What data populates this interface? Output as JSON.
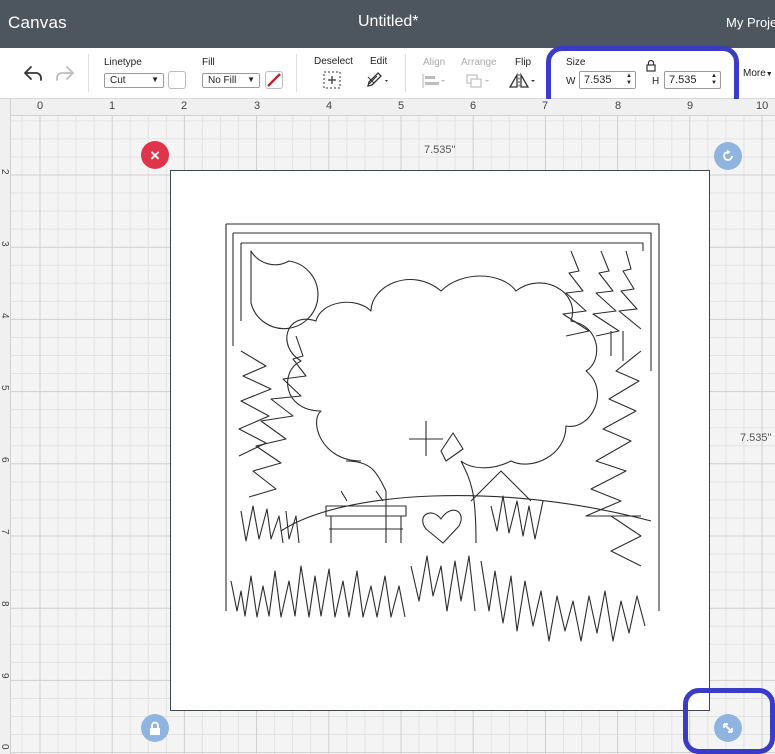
{
  "header": {
    "app_title": "Canvas",
    "doc_title": "Untitled*",
    "projects_link": "My Proje"
  },
  "toolbar": {
    "undo_icon": "undo-icon",
    "redo_icon": "redo-icon",
    "linetype_label": "Linetype",
    "linetype_value": "Cut",
    "fill_label": "Fill",
    "fill_value": "No Fill",
    "deselect_label": "Deselect",
    "edit_label": "Edit",
    "align_label": "Align",
    "arrange_label": "Arrange",
    "flip_label": "Flip",
    "size_label": "Size",
    "width_prefix": "W",
    "width_value": "7.535",
    "height_prefix": "H",
    "height_value": "7.535",
    "more_label": "More",
    "accent_color": "#3a3cc8"
  },
  "rulers": {
    "top": [
      "0",
      "1",
      "2",
      "3",
      "4",
      "5",
      "6",
      "7",
      "8",
      "9",
      "10"
    ],
    "left": [
      "2",
      "3",
      "4",
      "5",
      "6",
      "7",
      "8",
      "9",
      "0"
    ]
  },
  "canvas": {
    "width_dimension": "7.535\"",
    "height_dimension": "7.535\"",
    "delete_handle_color": "#e0344a",
    "handle_color": "#8fb4e0"
  }
}
